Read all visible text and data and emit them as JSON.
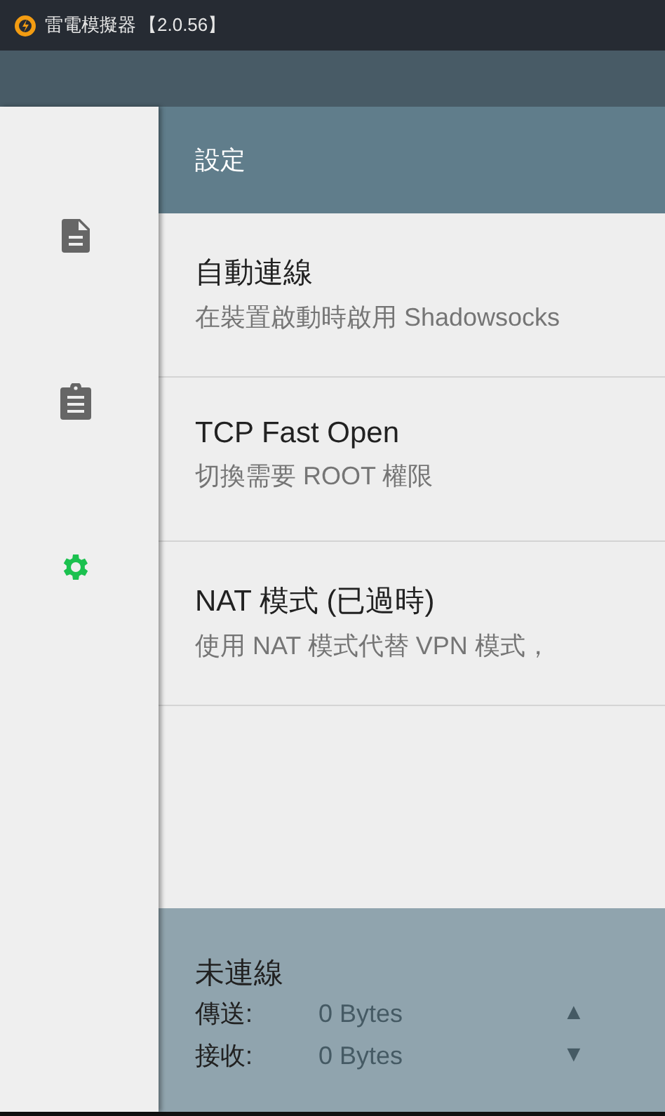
{
  "window": {
    "title": "雷電模擬器",
    "version": "【2.0.56】"
  },
  "sidebar": {
    "items": [
      {
        "kind": "document",
        "selected": false
      },
      {
        "kind": "clipboard",
        "selected": false
      },
      {
        "kind": "settings",
        "selected": true
      }
    ]
  },
  "header": {
    "title": "設定"
  },
  "settings": [
    {
      "title": "自動連線",
      "subtitle": "在裝置啟動時啟用 Shadowsocks"
    },
    {
      "title": "TCP Fast Open",
      "subtitle": "切換需要 ROOT 權限"
    },
    {
      "title": "NAT 模式 (已過時)",
      "subtitle": "使用 NAT 模式代替 VPN 模式，"
    }
  ],
  "status": {
    "state": "未連線",
    "rows": [
      {
        "label": "傳送:",
        "value": "0 Bytes",
        "arrow": "▲"
      },
      {
        "label": "接收:",
        "value": "0 Bytes",
        "arrow": "▼"
      }
    ]
  }
}
